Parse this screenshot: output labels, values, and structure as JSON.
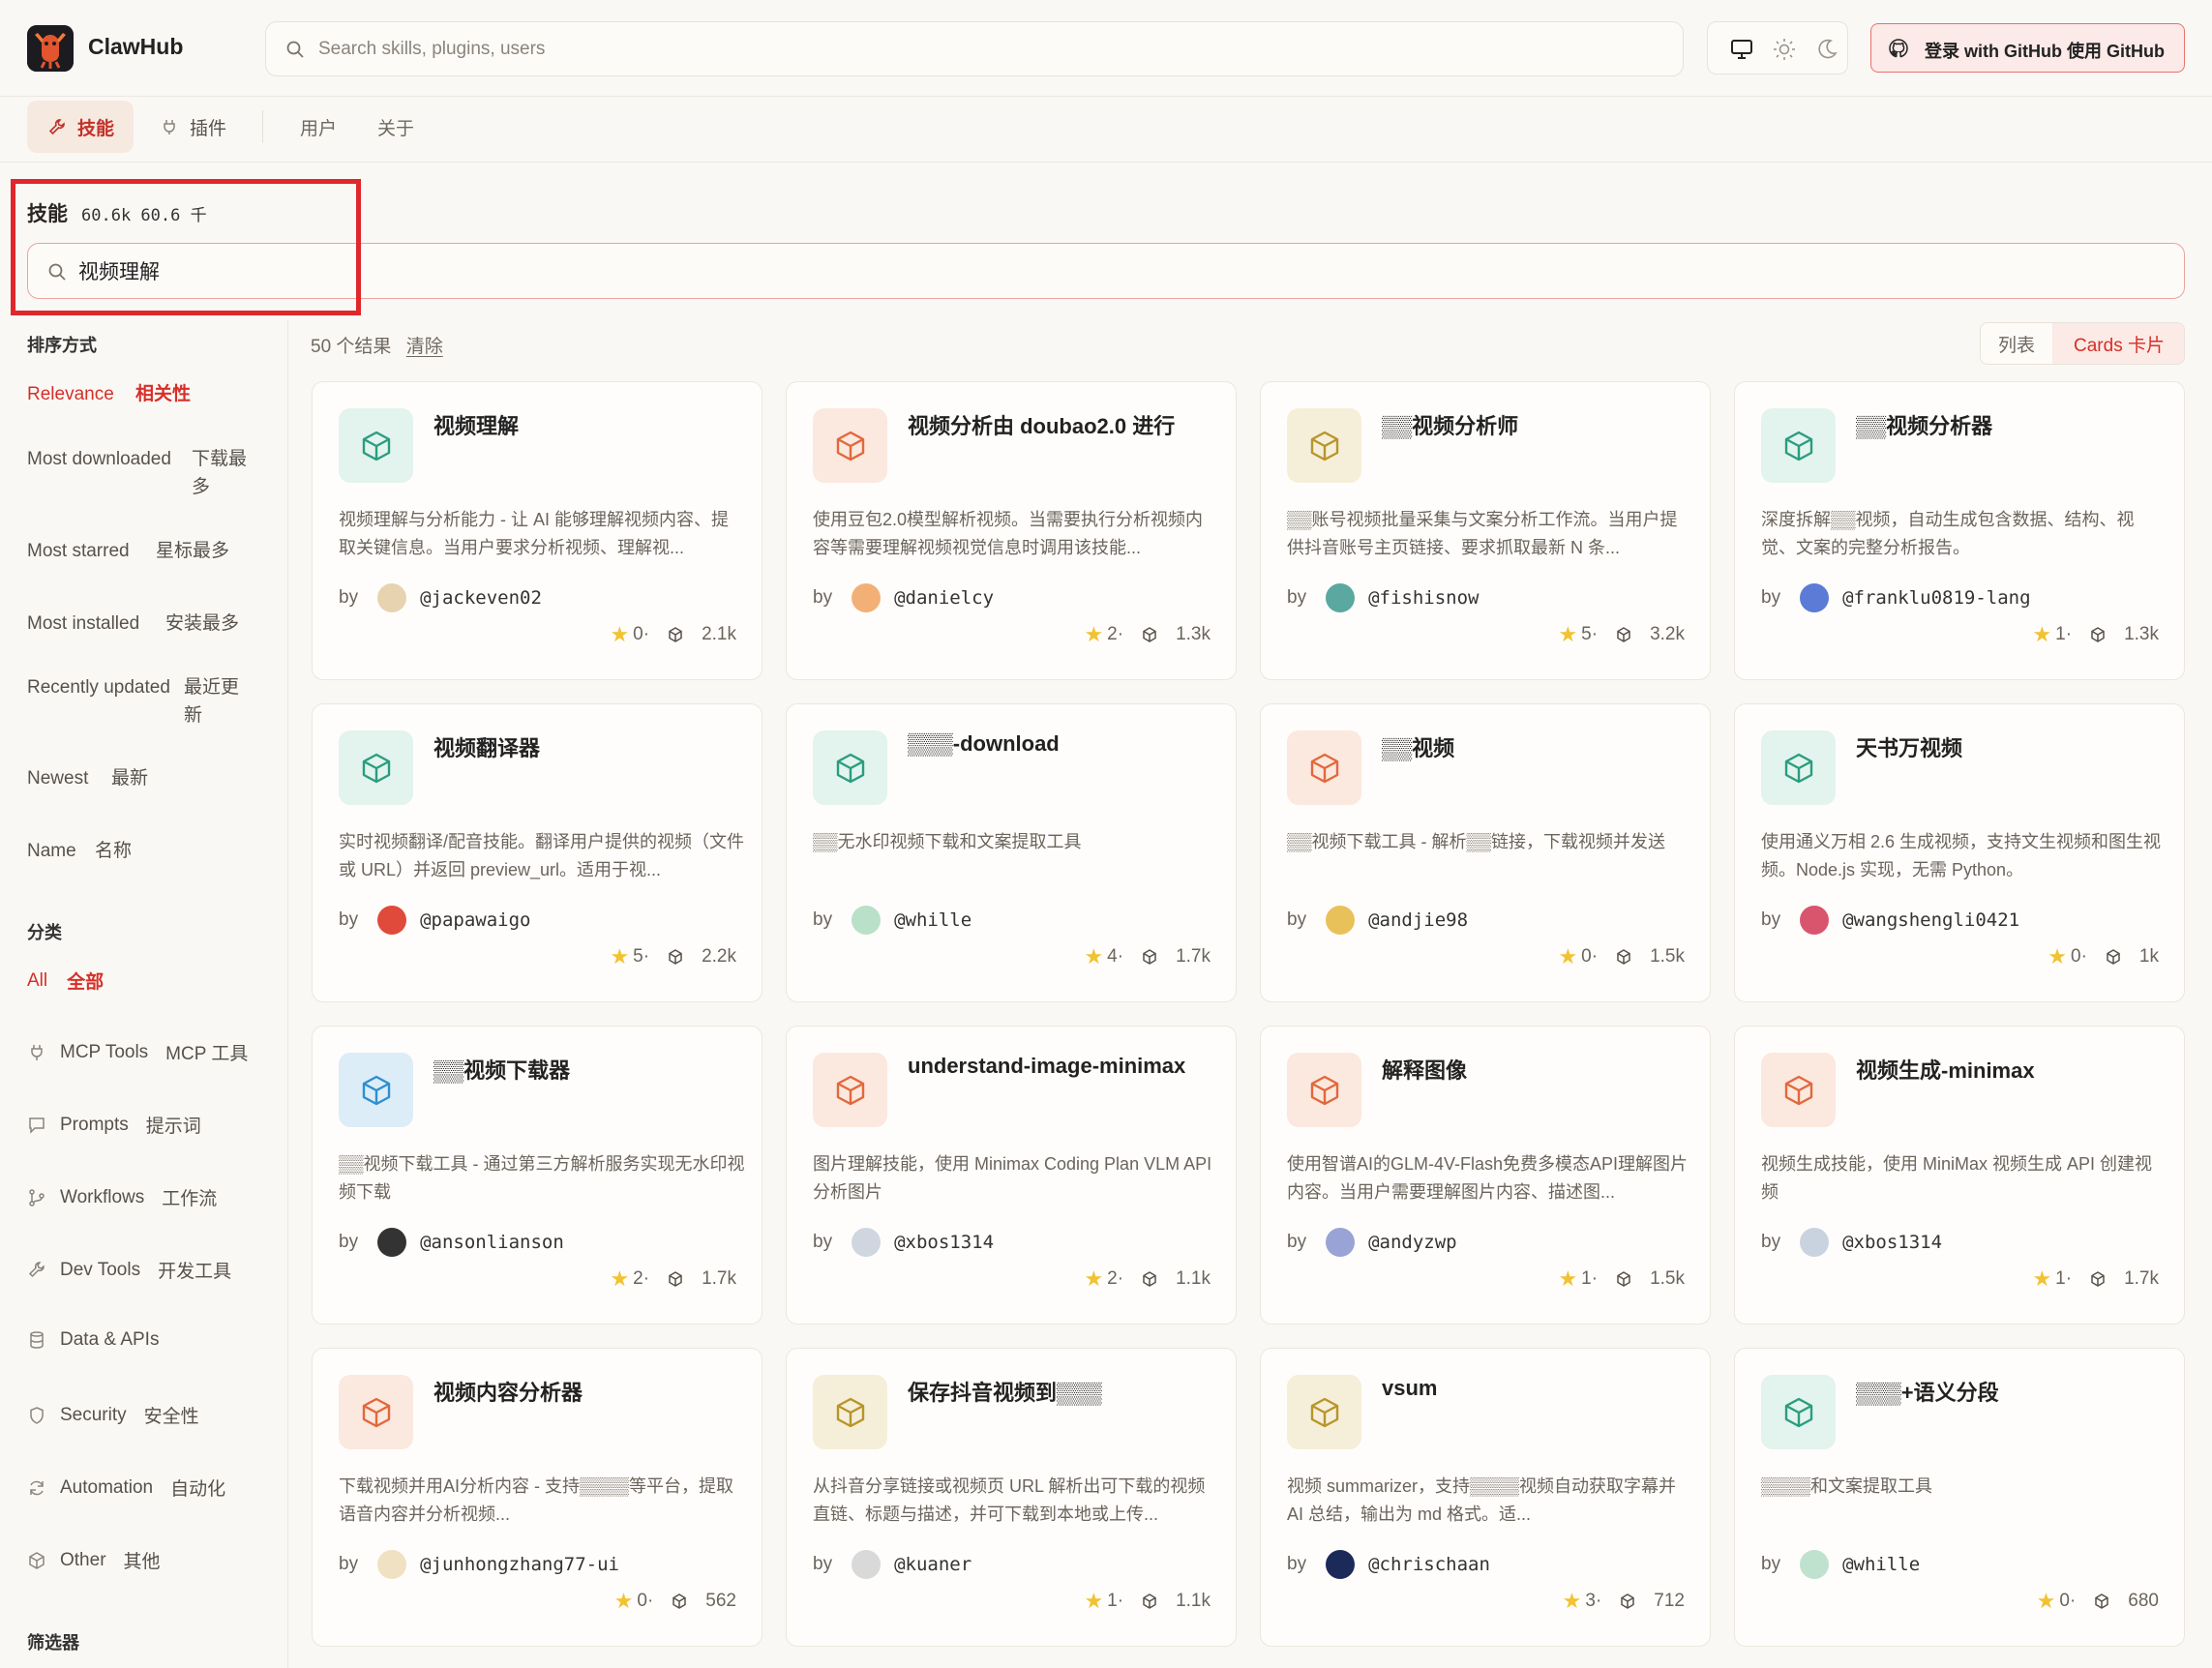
{
  "app": {
    "name": "ClawHub"
  },
  "header": {
    "search_placeholder": "Search skills, plugins, users",
    "login_label": "登录  with GitHub 使用 GitHub"
  },
  "nav": {
    "tabs": [
      {
        "label": "技能",
        "active": true
      },
      {
        "label": "插件",
        "active": false
      },
      {
        "label": "用户",
        "active": false
      },
      {
        "label": "关于",
        "active": false
      }
    ]
  },
  "section": {
    "title": "技能",
    "count": "60.6k   60.6 千"
  },
  "search": {
    "value": "视频理解"
  },
  "sort": {
    "heading": "排序方式",
    "options": [
      {
        "en": "Relevance",
        "zh": "相关性",
        "active": true
      },
      {
        "en": "Most downloaded",
        "zh": "下载最多"
      },
      {
        "en": "Most starred",
        "zh": "星标最多"
      },
      {
        "en": "Most installed",
        "zh": "安装最多"
      },
      {
        "en": "Recently updated",
        "zh": "最近更新"
      },
      {
        "en": "Newest",
        "zh": "最新"
      },
      {
        "en": "Name",
        "zh": "名称"
      }
    ]
  },
  "categories": {
    "heading": "分类",
    "all": {
      "en": "All",
      "zh": "全部"
    },
    "items": [
      {
        "en": "MCP Tools",
        "zh": "MCP 工具",
        "icon": "plug-icon"
      },
      {
        "en": "Prompts",
        "zh": "提示词",
        "icon": "chat-icon"
      },
      {
        "en": "Workflows",
        "zh": "工作流",
        "icon": "workflow-icon"
      },
      {
        "en": "Dev Tools",
        "zh": "开发工具",
        "icon": "wrench-icon"
      },
      {
        "en": "Data & APIs",
        "zh": "",
        "icon": "database-icon"
      },
      {
        "en": "Security",
        "zh": "安全性",
        "icon": "shield-icon"
      },
      {
        "en": "Automation",
        "zh": "自动化",
        "icon": "refresh-icon"
      },
      {
        "en": "Other",
        "zh": "其他",
        "icon": "cube-icon"
      }
    ],
    "filters_heading": "筛选器"
  },
  "results": {
    "count": "50 个结果",
    "clear": "清除"
  },
  "view": {
    "list": "列表",
    "cards": "Cards 卡片"
  },
  "colors": {
    "accent": "#d62f28",
    "teal": "#2a9d7e",
    "coral": "#e2683c",
    "olive": "#b8952a",
    "blue": "#2e8fd0"
  },
  "cards": [
    {
      "title": "视频理解",
      "desc": "视频理解与分析能力 - 让 AI 能够理解视频内容、提取关键信息。当用户要求分析视频、理解视...",
      "by": "by",
      "user": "@jackeven02",
      "stars": "0",
      "installs": "2.1k",
      "tone": "teal"
    },
    {
      "title": "视频分析由 doubao2.0 进行",
      "desc": "使用豆包2.0模型解析视频。当需要执行分析视频内容等需要理解视频视觉信息时调用该技能...",
      "by": "by",
      "user": "@danielcy",
      "stars": "2",
      "installs": "1.3k",
      "tone": "coral"
    },
    {
      "title": "▒▒视频分析师",
      "desc": "▒▒账号视频批量采集与文案分析工作流。当用户提供抖音账号主页链接、要求抓取最新 N 条...",
      "by": "by",
      "user": "@fishisnow",
      "stars": "5",
      "installs": "3.2k",
      "tone": "olive"
    },
    {
      "title": "▒▒视频分析器",
      "desc": "深度拆解▒▒视频，自动生成包含数据、结构、视觉、文案的完整分析报告。",
      "by": "by",
      "user": "@franklu0819-lang",
      "stars": "1",
      "installs": "1.3k",
      "tone": "teal"
    },
    {
      "title": "视频翻译器",
      "desc": "实时视频翻译/配音技能。翻译用户提供的视频（文件或 URL）并返回 preview_url。适用于视...",
      "by": "by",
      "user": "@papawaigo",
      "stars": "5",
      "installs": "2.2k",
      "tone": "teal"
    },
    {
      "title": "▒▒▒-download",
      "desc": "▒▒无水印视频下载和文案提取工具",
      "by": "by",
      "user": "@whille",
      "stars": "4",
      "installs": "1.7k",
      "tone": "teal"
    },
    {
      "title": "▒▒视频",
      "desc": "▒▒视频下载工具 - 解析▒▒链接，下载视频并发送",
      "by": "by",
      "user": "@andjie98",
      "stars": "0",
      "installs": "1.5k",
      "tone": "coral"
    },
    {
      "title": "天书万视频",
      "desc": "使用通义万相 2.6 生成视频，支持文生视频和图生视频。Node.js 实现，无需 Python。",
      "by": "by",
      "user": "@wangshengli0421",
      "stars": "0",
      "installs": "1k",
      "tone": "teal"
    },
    {
      "title": "▒▒视频下载器",
      "desc": "▒▒视频下载工具 - 通过第三方解析服务实现无水印视频下载",
      "by": "by",
      "user": "@ansonlianson",
      "stars": "2",
      "installs": "1.7k",
      "tone": "blue"
    },
    {
      "title": "understand-image-minimax",
      "desc": "图片理解技能，使用 Minimax Coding Plan VLM API 分析图片",
      "by": "by",
      "user": "@xbos1314",
      "stars": "2",
      "installs": "1.1k",
      "tone": "coral"
    },
    {
      "title": "解释图像",
      "desc": "使用智谱AI的GLM-4V-Flash免费多模态API理解图片内容。当用户需要理解图片内容、描述图...",
      "by": "by",
      "user": "@andyzwp",
      "stars": "1",
      "installs": "1.5k",
      "tone": "coral"
    },
    {
      "title": "视频生成-minimax",
      "desc": "视频生成技能，使用 MiniMax 视频生成 API 创建视频",
      "by": "by",
      "user": "@xbos1314",
      "stars": "1",
      "installs": "1.7k",
      "tone": "coral"
    },
    {
      "title": "视频内容分析器",
      "desc": "下载视频并用AI分析内容 - 支持▒▒▒▒等平台，提取语音内容并分析视频...",
      "by": "by",
      "user": "@junhongzhang77-ui",
      "stars": "0",
      "installs": "562",
      "tone": "coral"
    },
    {
      "title": "保存抖音视频到▒▒▒",
      "desc": "从抖音分享链接或视频页 URL 解析出可下载的视频直链、标题与描述，并可下载到本地或上传...",
      "by": "by",
      "user": "@kuaner",
      "stars": "1",
      "installs": "1.1k",
      "tone": "olive"
    },
    {
      "title": "vsum",
      "desc": "视频 summarizer，支持▒▒▒▒视频自动获取字幕并 AI 总结，输出为 md 格式。适...",
      "by": "by",
      "user": "@chrischaan",
      "stars": "3",
      "installs": "712",
      "tone": "olive"
    },
    {
      "title": "▒▒▒+语义分段",
      "desc": "▒▒▒▒和文案提取工具",
      "by": "by",
      "user": "@whille",
      "stars": "0",
      "installs": "680",
      "tone": "teal"
    }
  ]
}
